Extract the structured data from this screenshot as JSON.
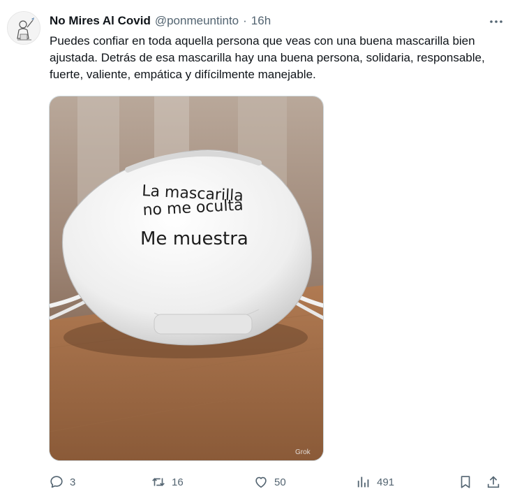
{
  "tweet": {
    "author_name": "No Mires Al Covid",
    "author_handle": "@ponmeuntinto",
    "separator": "·",
    "time": "16h",
    "text": "Puedes confiar en toda aquella persona que veas con una buena mascarilla bien ajustada. Detrás de esa mascarilla hay una buena persona, solidaria, responsable, fuerte, valiente, empática y difícilmente manejable.",
    "image": {
      "text_line1": "La mascarilla",
      "text_line2": "no me oculta",
      "text_line3": "Me muestra",
      "watermark": "Grok"
    }
  },
  "actions": {
    "reply_count": "3",
    "retweet_count": "16",
    "like_count": "50",
    "views_count": "491"
  },
  "icons": {
    "more": "more-dots-icon",
    "reply": "reply-icon",
    "retweet": "retweet-icon",
    "like": "heart-icon",
    "views": "views-icon",
    "bookmark": "bookmark-icon",
    "share": "share-icon"
  },
  "colors": {
    "text_primary": "#0f1419",
    "text_secondary": "#536471",
    "border": "#cfd9de"
  }
}
